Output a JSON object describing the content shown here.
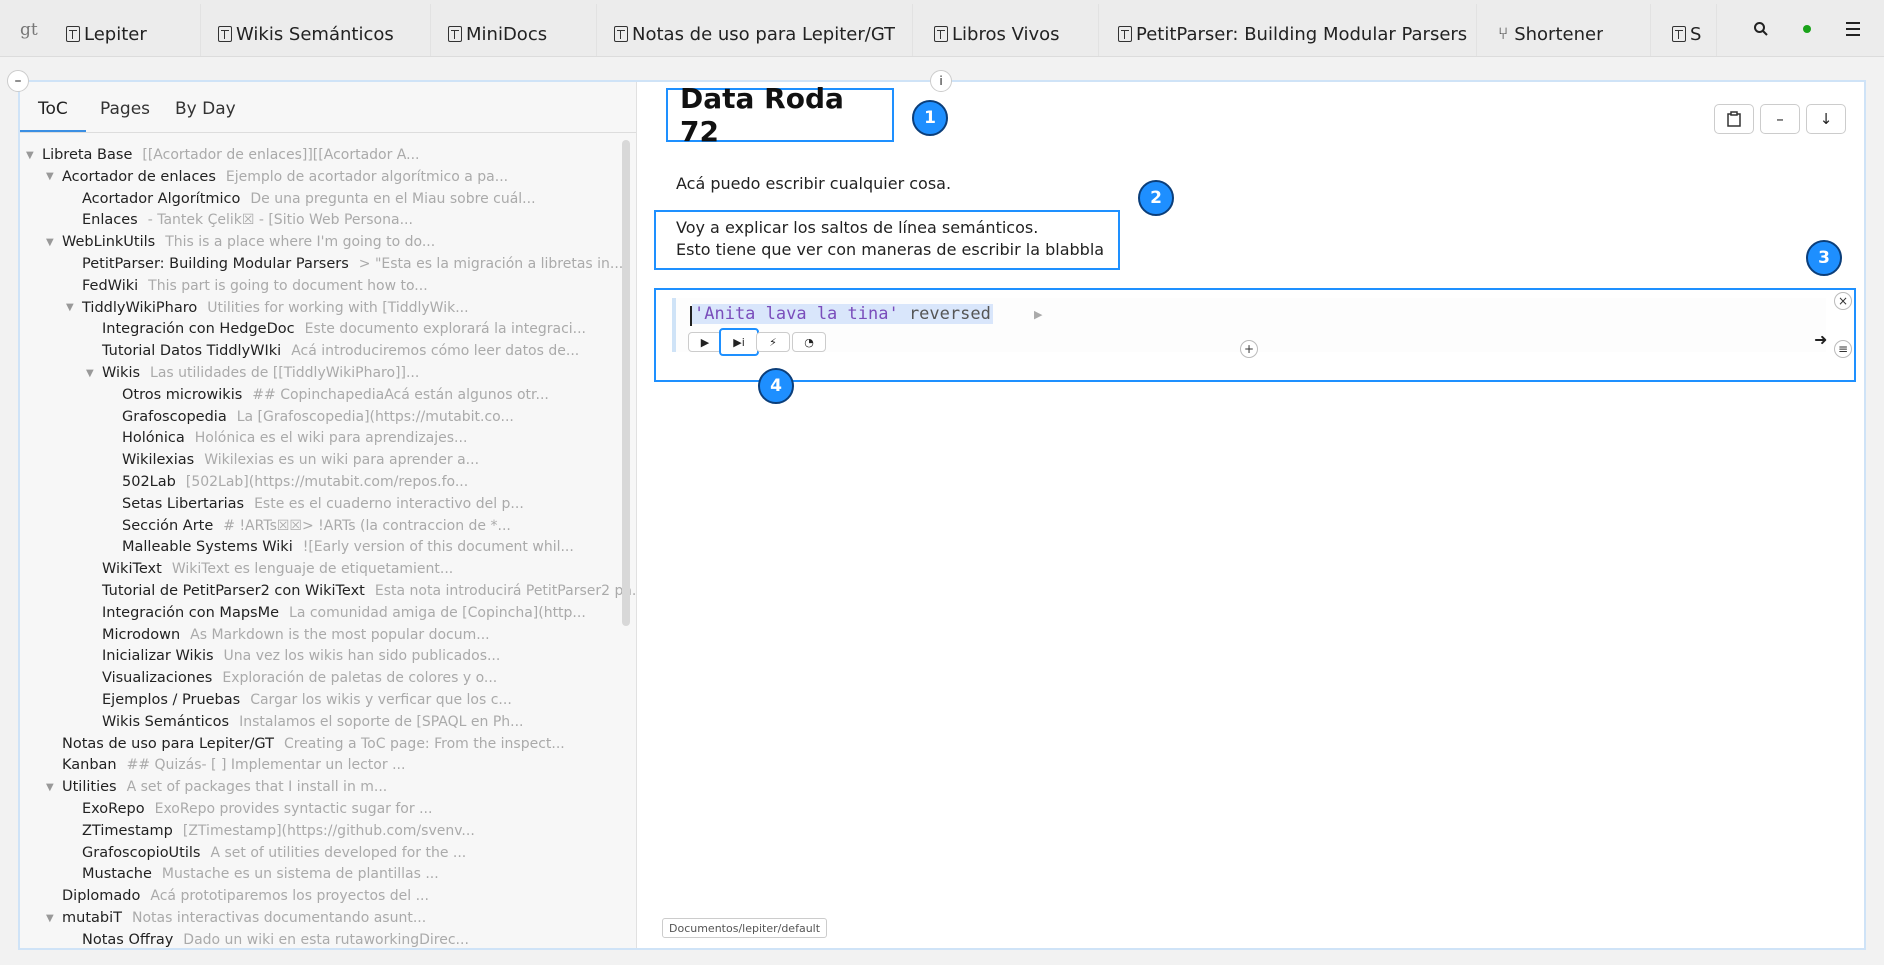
{
  "topbar": {
    "logo": "gt",
    "tabs": [
      {
        "label": "Lepiter",
        "icon": "lepiter-page-icon"
      },
      {
        "label": "Wikis Semánticos",
        "icon": "lepiter-page-icon"
      },
      {
        "label": "MiniDocs",
        "icon": "lepiter-page-icon"
      },
      {
        "label": "Notas de uso para Lepiter/GT",
        "icon": "lepiter-page-icon"
      },
      {
        "label": "Libros Vivos",
        "icon": "lepiter-page-icon"
      },
      {
        "label": "PetitParser: Building Modular Parsers",
        "icon": "lepiter-page-icon"
      },
      {
        "label": "Shortener",
        "icon": "branch-icon"
      },
      {
        "label": "S",
        "icon": "lepiter-page-icon"
      }
    ]
  },
  "sidebar": {
    "tabs": [
      "ToC",
      "Pages",
      "By Day"
    ],
    "tree": [
      {
        "label": "Libreta Base",
        "desc": "[[Acortador de enlaces]][[Acortador A...",
        "level": 0,
        "expand": true
      },
      {
        "label": "Acortador de enlaces",
        "desc": "Ejemplo de acortador algorítmico a pa...",
        "level": 1,
        "expand": true
      },
      {
        "label": "Acortador Algorítmico",
        "desc": "De una pregunta en el Miau sobre cuál...",
        "level": 2,
        "expand": false
      },
      {
        "label": "Enlaces",
        "desc": "- Tantek Çelik☒ - [Sitio Web Persona...",
        "level": 2,
        "expand": false
      },
      {
        "label": "WebLinkUtils",
        "desc": "This is a place where I'm going to do...",
        "level": 1,
        "expand": true
      },
      {
        "label": "PetitParser: Building Modular Parsers",
        "desc": "> \"Esta es la migración a libretas in...",
        "level": 2,
        "expand": false
      },
      {
        "label": "FedWiki",
        "desc": "This part is going to document how to...",
        "level": 2,
        "expand": false
      },
      {
        "label": "TiddlyWikiPharo",
        "desc": "Utilities for working with [TiddlyWik...",
        "level": 2,
        "expand": true
      },
      {
        "label": "Integración con HedgeDoc",
        "desc": "Este documento explorará la integraci...",
        "level": 3,
        "expand": false
      },
      {
        "label": "Tutorial Datos TiddlyWIki",
        "desc": "Acá introduciremos cómo leer datos de...",
        "level": 3,
        "expand": false
      },
      {
        "label": "Wikis",
        "desc": "Las utilidades de [[TiddlyWikiPharo]]...",
        "level": 3,
        "expand": true
      },
      {
        "label": "Otros microwikis",
        "desc": "## CopinchapediaAcá están algunos otr...",
        "level": 4,
        "expand": false
      },
      {
        "label": "Grafoscopedia",
        "desc": "La [Grafoscopedia](https://mutabit.co...",
        "level": 4,
        "expand": false
      },
      {
        "label": "Holónica",
        "desc": "Holónica es el wiki para aprendizajes...",
        "level": 4,
        "expand": false
      },
      {
        "label": "Wikilexias",
        "desc": "Wikilexias es un wiki para aprender a...",
        "level": 4,
        "expand": false
      },
      {
        "label": "502Lab",
        "desc": "[502Lab](https://mutabit.com/repos.fo...",
        "level": 4,
        "expand": false
      },
      {
        "label": "Setas Libertarias",
        "desc": "Este es el cuaderno interactivo del p...",
        "level": 4,
        "expand": false
      },
      {
        "label": "Sección Arte",
        "desc": "# !ARTs☒☒> !ARTs (la contraccion de *...",
        "level": 4,
        "expand": false
      },
      {
        "label": "Malleable Systems Wiki",
        "desc": "![Early version of this document whil...",
        "level": 4,
        "expand": false
      },
      {
        "label": "WikiText",
        "desc": "WikiText es lenguaje de etiquetamient...",
        "level": 3,
        "expand": false
      },
      {
        "label": "Tutorial de PetitParser2  con WikiText",
        "desc": "Esta nota introducirá PetitParser2 pa...",
        "level": 3,
        "expand": false
      },
      {
        "label": "Integración con MapsMe",
        "desc": "La comunidad amiga de [Copincha](http...",
        "level": 3,
        "expand": false
      },
      {
        "label": "Microdown",
        "desc": "As Markdown is the most popular docum...",
        "level": 3,
        "expand": false
      },
      {
        "label": "Inicializar Wikis",
        "desc": "Una vez los wikis han sido publicados...",
        "level": 3,
        "expand": false
      },
      {
        "label": "Visualizaciones",
        "desc": "Exploración de paletas de colores y o...",
        "level": 3,
        "expand": false
      },
      {
        "label": "Ejemplos / Pruebas",
        "desc": "Cargar los wikis y verficar que los c...",
        "level": 3,
        "expand": false
      },
      {
        "label": "Wikis Semánticos",
        "desc": "Instalamos el soporte de [SPAQL en Ph...",
        "level": 3,
        "expand": false
      },
      {
        "label": "Notas de uso para Lepiter/GT",
        "desc": "Creating a ToC page: From the inspect...",
        "level": 1,
        "expand": false
      },
      {
        "label": "Kanban",
        "desc": "## Quizás- [ ] Implementar un lector ...",
        "level": 1,
        "expand": false
      },
      {
        "label": "Utilities",
        "desc": "A set of packages that I install in m...",
        "level": 1,
        "expand": true
      },
      {
        "label": "ExoRepo",
        "desc": "ExoRepo provides syntactic sugar for ...",
        "level": 2,
        "expand": false
      },
      {
        "label": "ZTimestamp",
        "desc": "[ZTimestamp](https://github.com/svenv...",
        "level": 2,
        "expand": false
      },
      {
        "label": "GrafoscopioUtils",
        "desc": "A set of utilities developed for the ...",
        "level": 2,
        "expand": false
      },
      {
        "label": "Mustache",
        "desc": "Mustache es un sistema de plantillas ...",
        "level": 2,
        "expand": false
      },
      {
        "label": "Diplomado",
        "desc": "Acá prototiparemos los proyectos del ...",
        "level": 1,
        "expand": false
      },
      {
        "label": "mutabiT",
        "desc": "Notas interactivas documentando asunt...",
        "level": 1,
        "expand": true
      },
      {
        "label": "Notas Offray",
        "desc": "Dado un wiki en esta rutaworkingDirec...",
        "level": 2,
        "expand": false
      }
    ]
  },
  "page": {
    "title": "Data Roda 72",
    "paragraph1": "Acá puedo escribir cualquier cosa.",
    "paragraph2_line1": "Voy a explicar los saltos de línea semánticos.",
    "paragraph2_line2": "Esto tiene que ver con maneras de escribir  la blabbla",
    "code_string": "'Anita lava la tina'",
    "code_message": " reversed",
    "path": "Documentos/lepiter/default"
  },
  "badges": [
    "1",
    "2",
    "3",
    "4"
  ],
  "colors": {
    "accent": "#1e90ff",
    "badge": "#1e8fff",
    "status_dot": "#1aa31a"
  }
}
